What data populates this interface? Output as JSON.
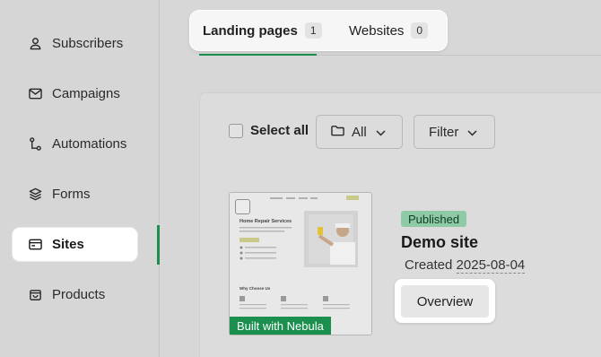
{
  "sidebar": {
    "items": [
      {
        "label": "Subscribers",
        "icon": "user-icon"
      },
      {
        "label": "Campaigns",
        "icon": "mail-icon"
      },
      {
        "label": "Automations",
        "icon": "workflow-icon"
      },
      {
        "label": "Forms",
        "icon": "layers-icon"
      },
      {
        "label": "Sites",
        "icon": "browser-icon",
        "active": true
      },
      {
        "label": "Products",
        "icon": "bag-icon"
      }
    ]
  },
  "tabs": [
    {
      "label": "Landing pages",
      "count": "1"
    },
    {
      "label": "Websites",
      "count": "0"
    }
  ],
  "toolbar": {
    "select_all": "Select all",
    "folder_filter": "All",
    "filter": "Filter"
  },
  "site": {
    "thumbnail_badge": "Built with Nebula",
    "status": "Published",
    "name": "Demo site",
    "created_label": "Created",
    "created_date": "2025-08-04",
    "overview_button": "Overview"
  },
  "thumbnail": {
    "heading": "Home Repair Services",
    "section": "Why Choose Us"
  },
  "colors": {
    "accent": "#1a8f4e",
    "published_bg": "#8fcaa7"
  }
}
